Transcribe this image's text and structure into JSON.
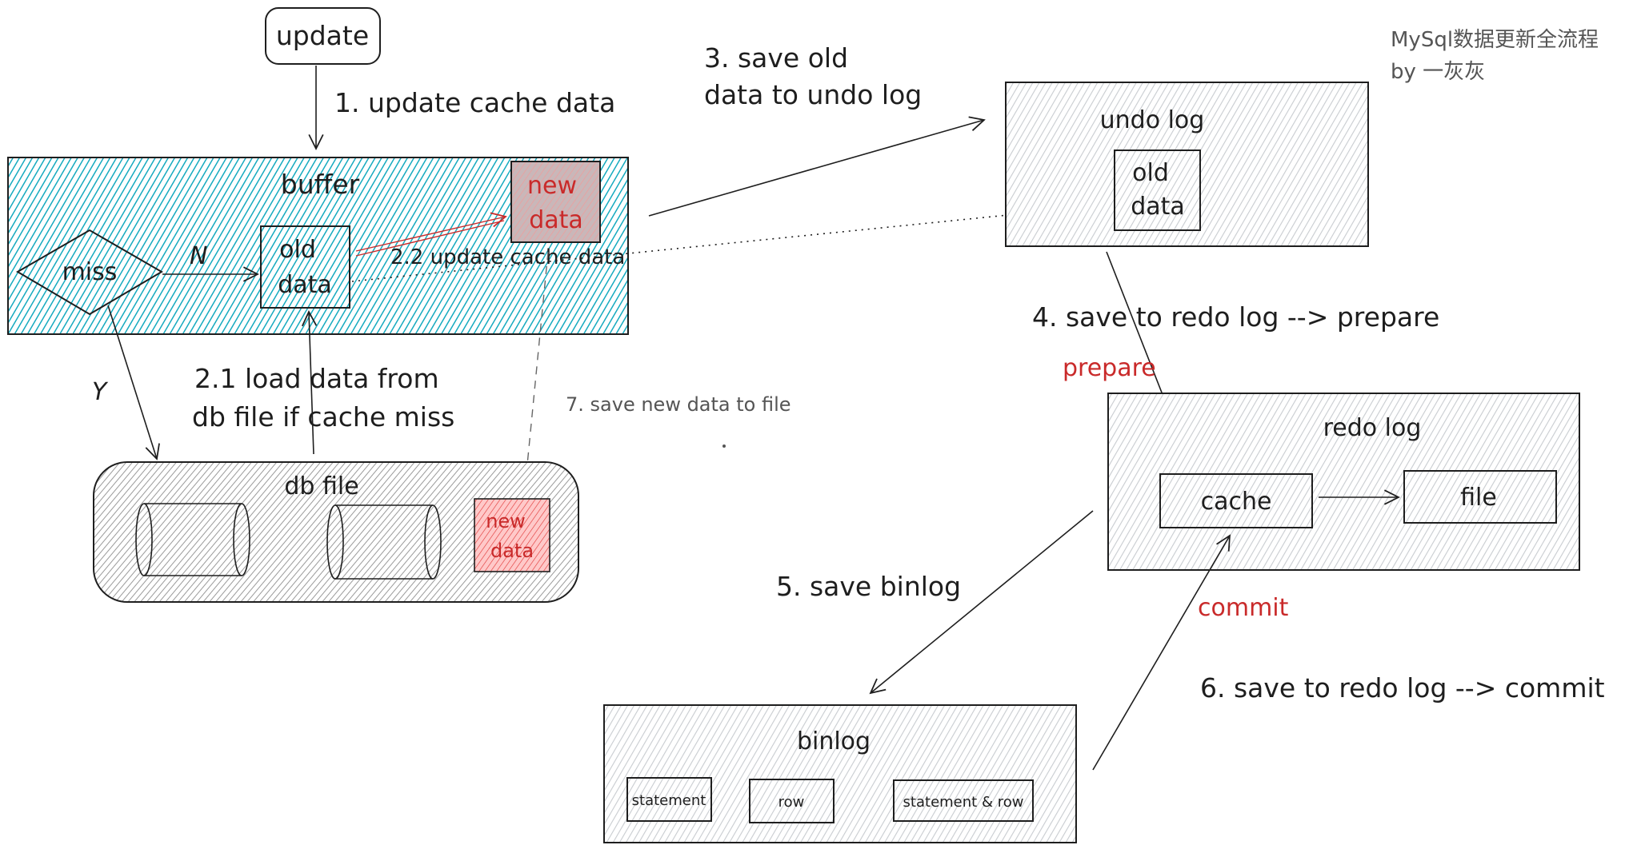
{
  "title": {
    "line1": "MySql数据更新全流程",
    "line2": "by 一灰灰"
  },
  "colors": {
    "buffer_fill": "#15aabf",
    "new_data_fill": "#ffc9c9",
    "new_data_text": "#c92a2a",
    "log_fill": "#ced4da",
    "stroke": "#1e1e1e"
  },
  "nodes": {
    "update": "update",
    "buffer": "buffer",
    "miss": "miss",
    "old_data_line1": "old",
    "old_data_line2": "data",
    "new_data_line1": "new",
    "new_data_line2": "data",
    "db_file": "db file",
    "db_new_data_line1": "new",
    "db_new_data_line2": "data",
    "undo_log": "undo log",
    "undo_old_data_line1": "old",
    "undo_old_data_line2": "data",
    "redo_log": "redo log",
    "redo_cache": "cache",
    "redo_file": "file",
    "binlog": "binlog",
    "binlog_formats": [
      "statement",
      "row",
      "statement & row"
    ]
  },
  "edges": {
    "step1": "1. update cache data",
    "n_label": "N",
    "y_label": "Y",
    "step2_1_line1": "2.1 load data from",
    "step2_1_line2": "db file if cache miss",
    "step2_2": "2.2 update cache data",
    "step3_line1": "3. save old",
    "step3_line2": "data to undo log",
    "step4": "4. save to redo log --> prepare",
    "prepare": "prepare",
    "step5": "5. save binlog",
    "step6": "6. save to redo log --> commit",
    "commit": "commit",
    "step7": "7. save new data to file"
  }
}
